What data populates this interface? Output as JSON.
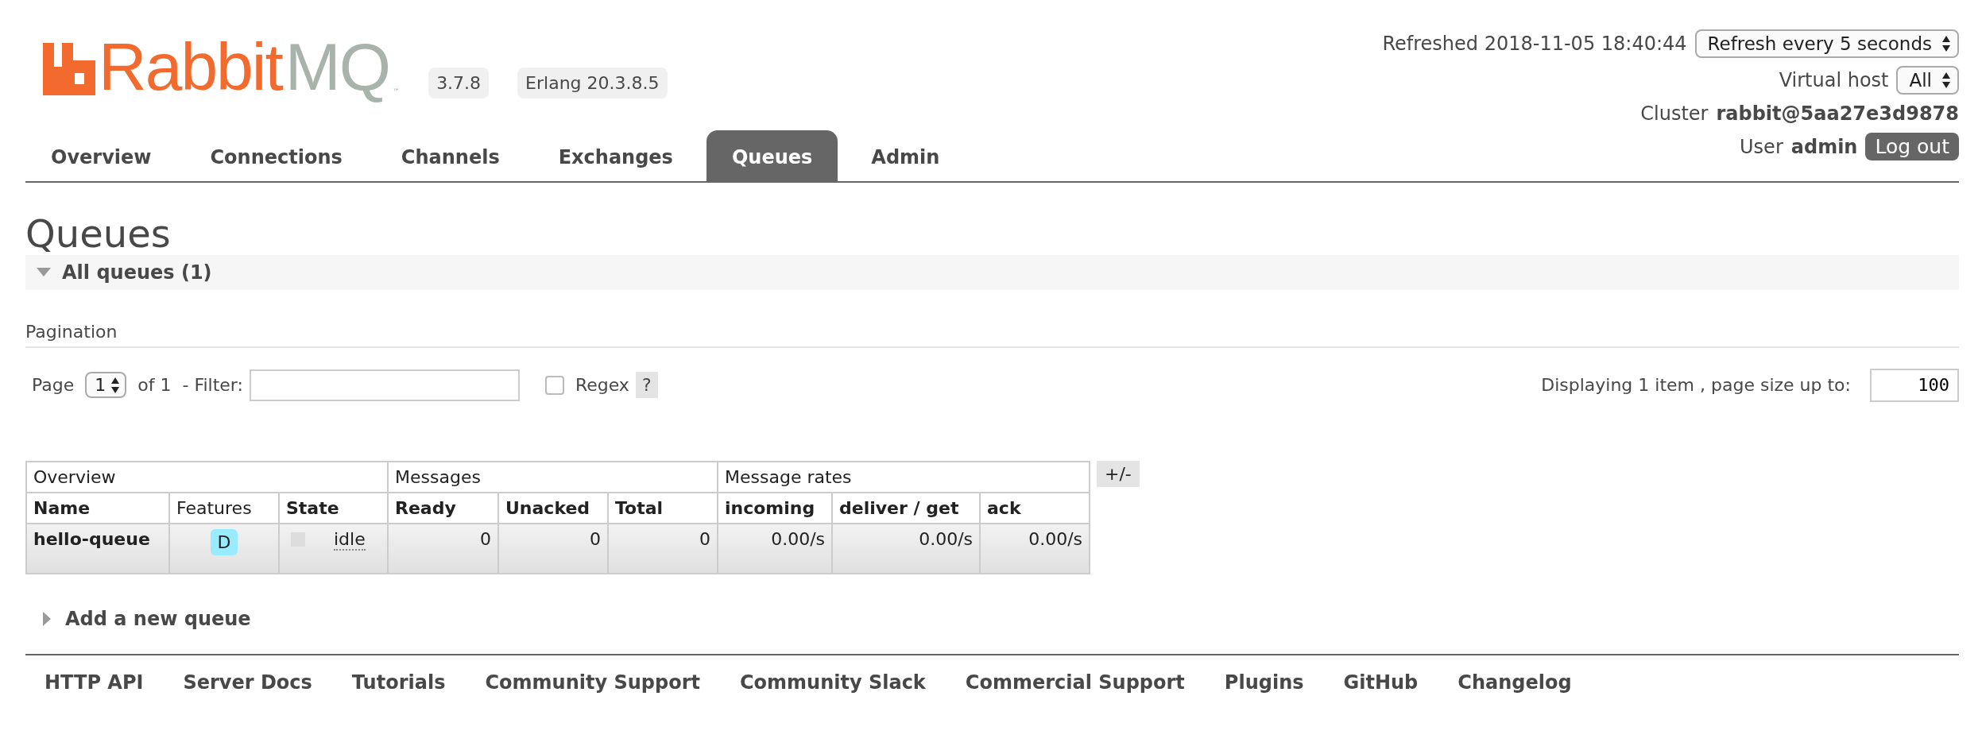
{
  "logo": {
    "brand_primary": "Rabbit",
    "brand_secondary": "MQ",
    "trademark": "™"
  },
  "versions": [
    "3.7.8",
    "Erlang 20.3.8.5"
  ],
  "header_info": {
    "refreshed": "Refreshed 2018-11-05 18:40:44",
    "refresh_select": "Refresh every 5 seconds",
    "vhost_label": "Virtual host",
    "vhost_select": "All",
    "cluster_label": "Cluster",
    "cluster_name": "rabbit@5aa27e3d9878",
    "user_label": "User",
    "user_name": "admin",
    "logout": "Log out"
  },
  "tabs": [
    {
      "label": "Overview",
      "selected": false
    },
    {
      "label": "Connections",
      "selected": false
    },
    {
      "label": "Channels",
      "selected": false
    },
    {
      "label": "Exchanges",
      "selected": false
    },
    {
      "label": "Queues",
      "selected": true
    },
    {
      "label": "Admin",
      "selected": false
    }
  ],
  "page_title": "Queues",
  "section": {
    "title": "All queues (1)",
    "expanded": true
  },
  "pagination": {
    "heading": "Pagination",
    "page_label": "Page",
    "page_value": "1",
    "of_label": "of 1",
    "filter_label": "- Filter:",
    "regex_label": "Regex",
    "regex_checked": false,
    "help": "?",
    "displaying": "Displaying 1 item , page size up to:",
    "page_size": "100"
  },
  "table": {
    "groups": [
      {
        "label": "Overview"
      },
      {
        "label": "Messages"
      },
      {
        "label": "Message rates"
      }
    ],
    "toggle": "+/-",
    "columns": [
      {
        "label": "Name",
        "bold": true
      },
      {
        "label": "Features",
        "bold": false
      },
      {
        "label": "State",
        "bold": true
      },
      {
        "label": "Ready",
        "bold": true
      },
      {
        "label": "Unacked",
        "bold": true
      },
      {
        "label": "Total",
        "bold": true
      },
      {
        "label": "incoming",
        "bold": true
      },
      {
        "label": "deliver / get",
        "bold": true
      },
      {
        "label": "ack",
        "bold": true
      }
    ],
    "rows": [
      {
        "name": "hello-queue",
        "feature": "D",
        "state": "idle",
        "ready": "0",
        "unacked": "0",
        "total": "0",
        "incoming": "0.00/s",
        "deliver_get": "0.00/s",
        "ack": "0.00/s"
      }
    ]
  },
  "add_queue": {
    "title": "Add a new queue",
    "expanded": false
  },
  "footer_links": [
    "HTTP API",
    "Server Docs",
    "Tutorials",
    "Community Support",
    "Community Slack",
    "Commercial Support",
    "Plugins",
    "GitHub",
    "Changelog"
  ]
}
